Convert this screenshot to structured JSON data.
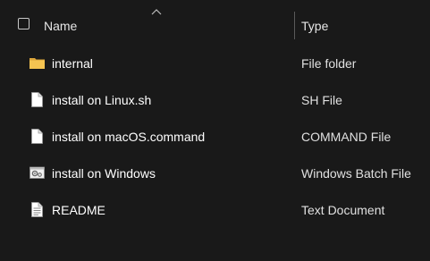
{
  "header": {
    "name_label": "Name",
    "type_label": "Type",
    "sort_indicator": "chevron-up-icon"
  },
  "files": [
    {
      "name": "internal",
      "type": "File folder",
      "icon": "folder-icon"
    },
    {
      "name": "install on Linux.sh",
      "type": "SH File",
      "icon": "blank-file-icon"
    },
    {
      "name": "install on macOS.command",
      "type": "COMMAND File",
      "icon": "blank-file-icon"
    },
    {
      "name": "install on Windows",
      "type": "Windows Batch File",
      "icon": "batch-file-icon"
    },
    {
      "name": "README",
      "type": "Text Document",
      "icon": "text-file-icon"
    }
  ],
  "colors": {
    "background": "#191919",
    "text": "#ffffff",
    "folder": "#f5c451",
    "divider": "#5a5a5a"
  }
}
